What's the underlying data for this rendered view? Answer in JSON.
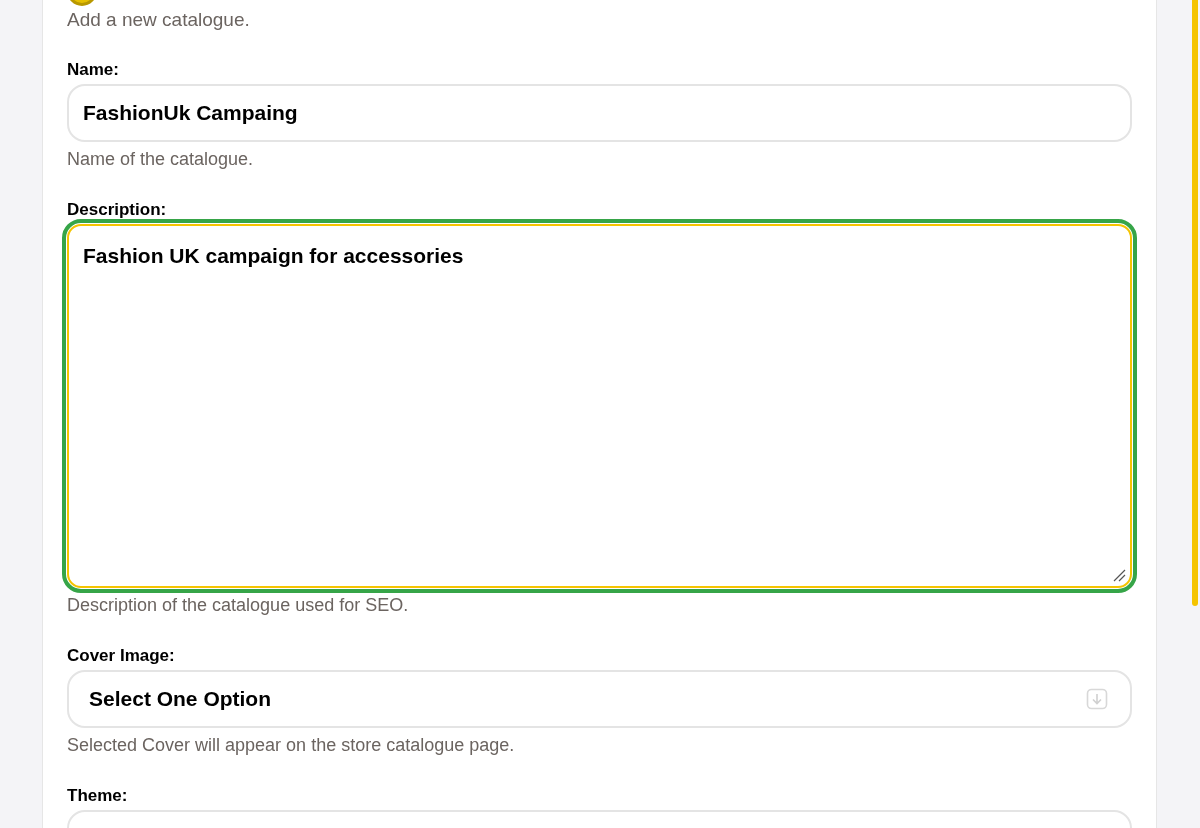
{
  "intro": "Add a new catalogue.",
  "fields": [
    {
      "kind": "input",
      "label": "Name:",
      "value": "FashionUk Campaing",
      "helper": "Name of the catalogue.",
      "focused": false
    },
    {
      "kind": "textarea",
      "label": "Description:",
      "value": "Fashion UK campaign for accessories",
      "helper": "Description of the catalogue used for SEO.",
      "focused": true
    },
    {
      "kind": "select",
      "label": "Cover Image:",
      "value": "Select One Option",
      "helper": "Selected Cover will appear on the store catalogue page.",
      "focused": false
    },
    {
      "kind": "input",
      "label": "Theme:",
      "focused": false
    }
  ]
}
